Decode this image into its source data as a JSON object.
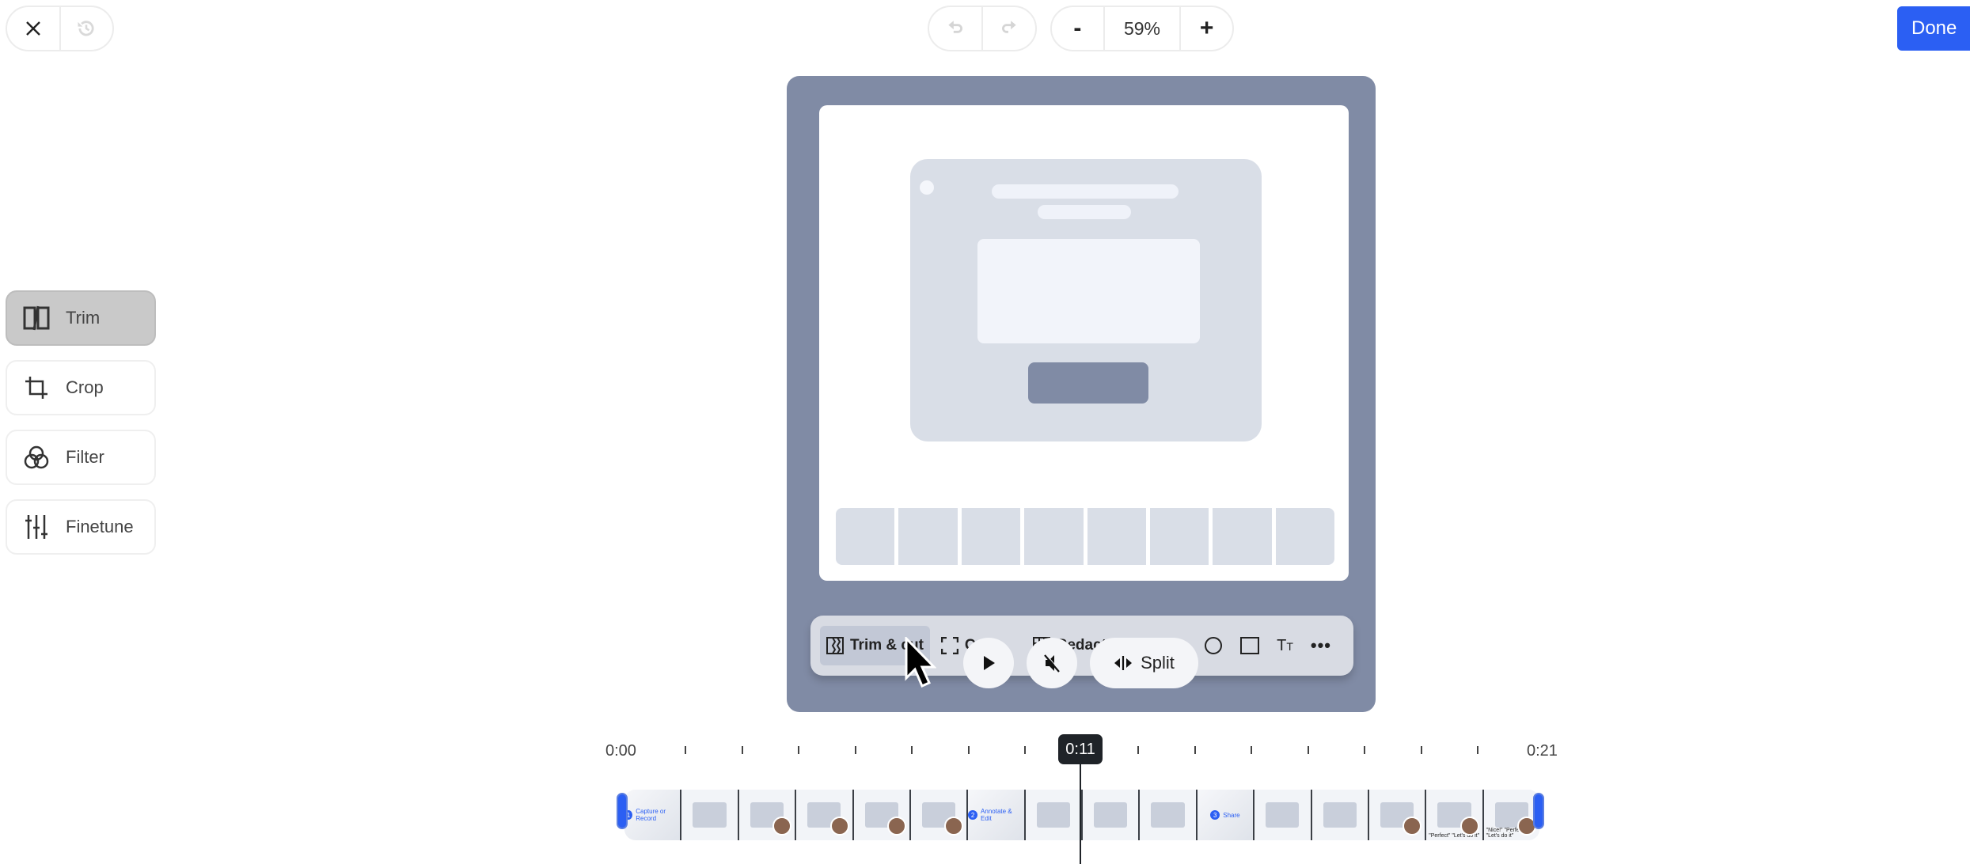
{
  "topbar": {
    "close_icon": "close-icon",
    "history_icon": "history-icon",
    "undo_icon": "undo-icon",
    "redo_icon": "redo-icon",
    "zoom_out_label": "-",
    "zoom_level": "59%",
    "zoom_in_label": "+",
    "done_label": "Done"
  },
  "sidebar": {
    "items": [
      {
        "label": "Trim",
        "icon": "trim-icon",
        "active": true
      },
      {
        "label": "Crop",
        "icon": "crop-icon",
        "active": false
      },
      {
        "label": "Filter",
        "icon": "filter-icon",
        "active": false
      },
      {
        "label": "Finetune",
        "icon": "finetune-icon",
        "active": false
      }
    ]
  },
  "preview": {
    "toolbar": {
      "trim_cut_label": "Trim & cut",
      "crop_label": "C",
      "redact_label": "Redact"
    },
    "controls": {
      "play_icon": "play-icon",
      "mute_icon": "mute-icon",
      "split_label": "Split"
    }
  },
  "timeline": {
    "start_time": "0:00",
    "end_time": "0:21",
    "current_time": "0:11",
    "thumbnails": [
      {
        "caption": "Capture or Record",
        "step": "1"
      },
      {
        "caption": ""
      },
      {
        "caption": ""
      },
      {
        "caption": ""
      },
      {
        "caption": ""
      },
      {
        "caption": ""
      },
      {
        "caption": "Annotate & Edit",
        "step": "2"
      },
      {
        "caption": ""
      },
      {
        "caption": ""
      },
      {
        "caption": ""
      },
      {
        "caption": "Share",
        "step": "3"
      },
      {
        "caption": ""
      },
      {
        "caption": ""
      },
      {
        "caption": ""
      },
      {
        "caption": "\"Perfect\" \"Let's do it\""
      },
      {
        "caption": "\"Nice!\" \"Perfect\" \"Let's do it\""
      }
    ]
  },
  "colors": {
    "accent": "#2b5ff3",
    "active_tool": "#c9c9c9",
    "video_bg": "#808ba5"
  }
}
